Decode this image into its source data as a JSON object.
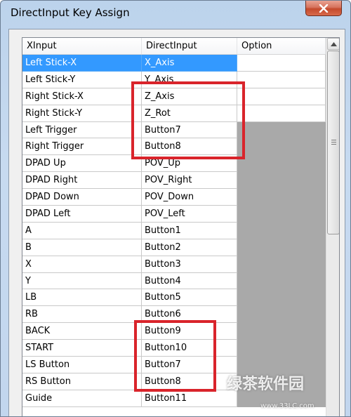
{
  "window": {
    "title": "DirectInput Key Assign"
  },
  "table": {
    "columns": [
      "XInput",
      "DirectInput",
      "Option"
    ],
    "rows": [
      {
        "xinput": "Left Stick-X",
        "directinput": "X_Axis",
        "option": "",
        "selected": true,
        "option_disabled": false
      },
      {
        "xinput": "Left Stick-Y",
        "directinput": "Y_Axis",
        "option": "",
        "selected": false,
        "option_disabled": false
      },
      {
        "xinput": "Right Stick-X",
        "directinput": "Z_Axis",
        "option": "",
        "selected": false,
        "option_disabled": false
      },
      {
        "xinput": "Right Stick-Y",
        "directinput": "Z_Rot",
        "option": "",
        "selected": false,
        "option_disabled": false
      },
      {
        "xinput": "Left Trigger",
        "directinput": "Button7",
        "option": "",
        "selected": false,
        "option_disabled": true
      },
      {
        "xinput": "Right Trigger",
        "directinput": "Button8",
        "option": "",
        "selected": false,
        "option_disabled": true
      },
      {
        "xinput": "DPAD Up",
        "directinput": "POV_Up",
        "option": "",
        "selected": false,
        "option_disabled": true
      },
      {
        "xinput": "DPAD Right",
        "directinput": "POV_Right",
        "option": "",
        "selected": false,
        "option_disabled": true
      },
      {
        "xinput": "DPAD Down",
        "directinput": "POV_Down",
        "option": "",
        "selected": false,
        "option_disabled": true
      },
      {
        "xinput": "DPAD Left",
        "directinput": "POV_Left",
        "option": "",
        "selected": false,
        "option_disabled": true
      },
      {
        "xinput": "A",
        "directinput": "Button1",
        "option": "",
        "selected": false,
        "option_disabled": true
      },
      {
        "xinput": "B",
        "directinput": "Button2",
        "option": "",
        "selected": false,
        "option_disabled": true
      },
      {
        "xinput": "X",
        "directinput": "Button3",
        "option": "",
        "selected": false,
        "option_disabled": true
      },
      {
        "xinput": "Y",
        "directinput": "Button4",
        "option": "",
        "selected": false,
        "option_disabled": true
      },
      {
        "xinput": "LB",
        "directinput": "Button5",
        "option": "",
        "selected": false,
        "option_disabled": true
      },
      {
        "xinput": "RB",
        "directinput": "Button6",
        "option": "",
        "selected": false,
        "option_disabled": true
      },
      {
        "xinput": "BACK",
        "directinput": "Button9",
        "option": "",
        "selected": false,
        "option_disabled": true
      },
      {
        "xinput": "START",
        "directinput": "Button10",
        "option": "",
        "selected": false,
        "option_disabled": true
      },
      {
        "xinput": "LS Button",
        "directinput": "Button7",
        "option": "",
        "selected": false,
        "option_disabled": true
      },
      {
        "xinput": "RS Button",
        "directinput": "Button8",
        "option": "",
        "selected": false,
        "option_disabled": true
      },
      {
        "xinput": "Guide",
        "directinput": "Button11",
        "option": "",
        "selected": false,
        "option_disabled": true
      }
    ]
  },
  "watermark": {
    "text": "绿茶软件园",
    "url": "www.33LC.com"
  },
  "colors": {
    "selection": "#3399ff",
    "disabled_cell": "#a9a9a9",
    "highlight_box": "#d9242b"
  },
  "icons": {
    "close": "close-icon",
    "scroll_up": "scroll-up-arrow-icon",
    "thumb_grip": "scroll-grip-icon"
  }
}
